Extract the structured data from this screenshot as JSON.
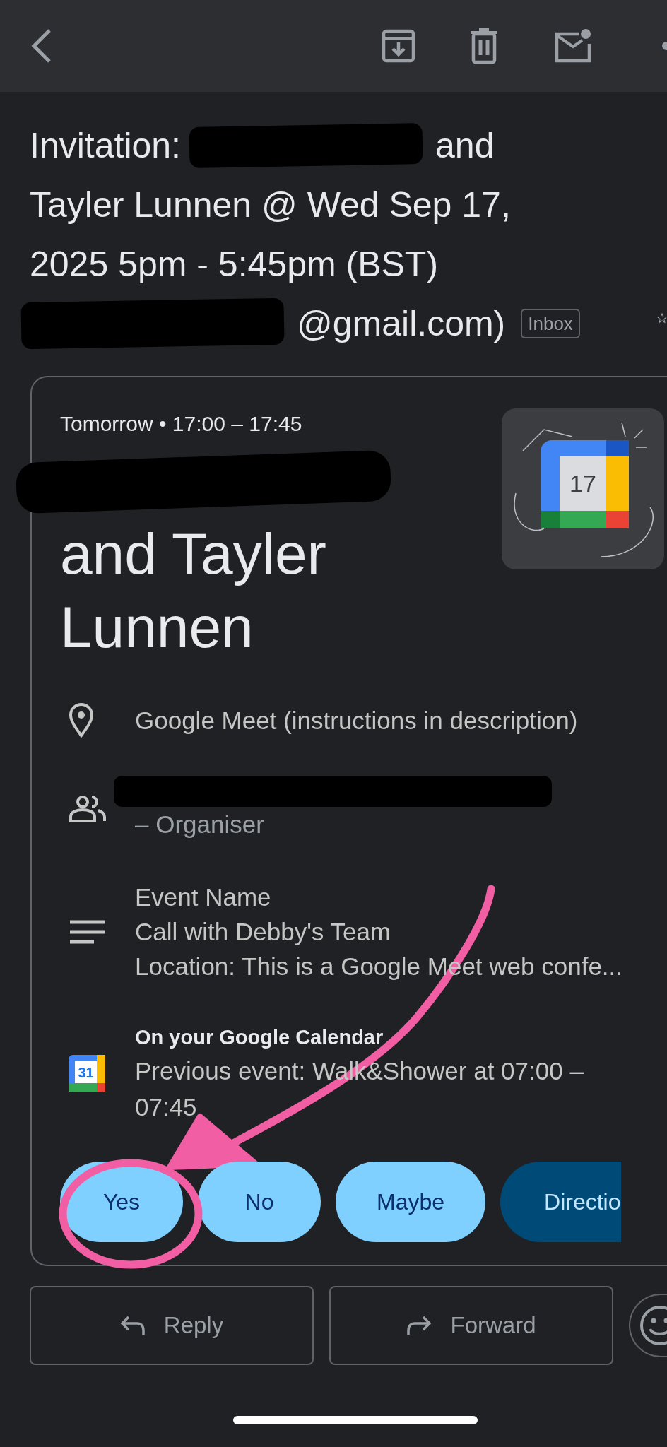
{
  "subject": {
    "lines": [
      {
        "parts": [
          {
            "kind": "text",
            "text": "Invitation:"
          },
          {
            "kind": "redacted"
          },
          {
            "kind": "text",
            "text": "and"
          }
        ]
      },
      {
        "parts": [
          {
            "kind": "text",
            "text": "Tayler Lunnen @ Wed Sep 17,"
          }
        ]
      },
      {
        "parts": [
          {
            "kind": "text",
            "text": "2025 5pm - 5:45pm (BST)"
          }
        ]
      },
      {
        "parts": [
          {
            "kind": "redacted"
          },
          {
            "kind": "text",
            "text": "@gmail.com)"
          }
        ]
      }
    ],
    "label": "Inbox"
  },
  "card": {
    "when": "Tomorrow • 17:00 – 17:45",
    "title_parts": [
      {
        "kind": "redacted"
      },
      {
        "kind": "text",
        "text": "and Tayler Lunnen"
      }
    ],
    "tile_day": "17",
    "details": [
      {
        "kind": "location",
        "lines": [
          {
            "kind": "text",
            "text": "Google Meet (instructions in description)"
          }
        ]
      },
      {
        "kind": "people",
        "lines": [
          {
            "kind": "redacted"
          },
          {
            "kind": "text",
            "text": "– Organiser"
          }
        ]
      },
      {
        "kind": "description",
        "lines": [
          {
            "kind": "text",
            "text": "Event Name"
          },
          {
            "kind": "text",
            "text": "Call with Debby's Team"
          },
          {
            "kind": "text",
            "text": "Location: This is a Google Meet web confe..."
          }
        ]
      },
      {
        "kind": "calendar",
        "icon_text": "31",
        "heading": "On your Google Calendar",
        "lines": [
          {
            "kind": "text",
            "text": "Previous event: Walk&Shower at 07:00 – 07:45"
          }
        ]
      }
    ],
    "buttons": [
      {
        "label": "Yes",
        "kind": "rsvp"
      },
      {
        "label": "No",
        "kind": "rsvp"
      },
      {
        "label": "Maybe",
        "kind": "rsvp"
      },
      {
        "label": "Directio",
        "kind": "link"
      }
    ]
  },
  "actions": [
    {
      "label": "Reply",
      "kind": "reply"
    },
    {
      "label": "Forward",
      "kind": "forward"
    }
  ]
}
